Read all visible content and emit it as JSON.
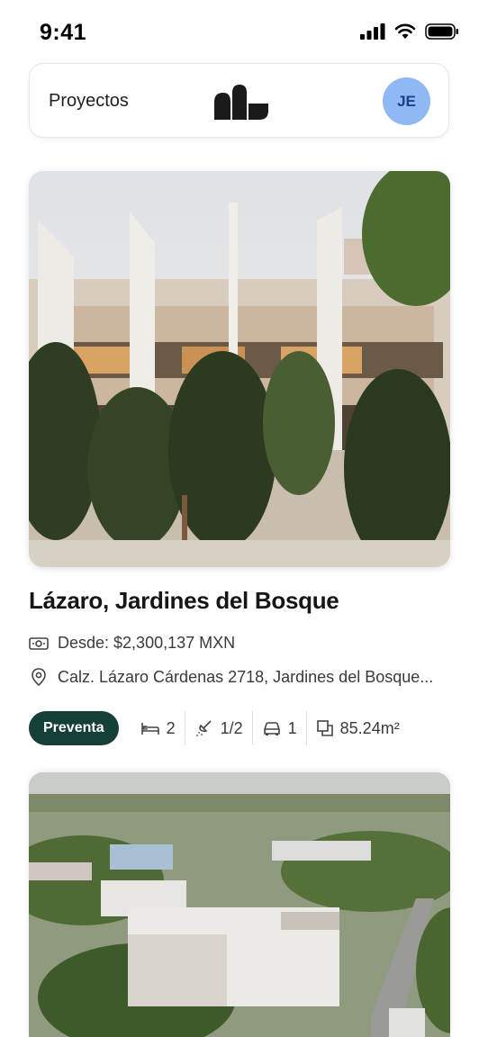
{
  "status_bar": {
    "time": "9:41",
    "icons": [
      "signal-icon",
      "wifi-icon",
      "battery-icon"
    ]
  },
  "header": {
    "title": "Proyectos",
    "logo": "brand-logo-icon",
    "avatar_initials": "JE",
    "avatar_color": "#8fb8f5"
  },
  "projects": [
    {
      "name": "Lázaro, Jardines del Bosque",
      "price": "Desde: $2,300,137 MXN",
      "address": "Calz. Lázaro Cárdenas 2718, Jardines del Bosque...",
      "status": "Preventa",
      "bedrooms": "2",
      "bathrooms": "1/2",
      "parking": "1",
      "area": "85.24m²"
    }
  ],
  "colors": {
    "badge": "#163f37",
    "accent_avatar": "#8fb8f5"
  }
}
